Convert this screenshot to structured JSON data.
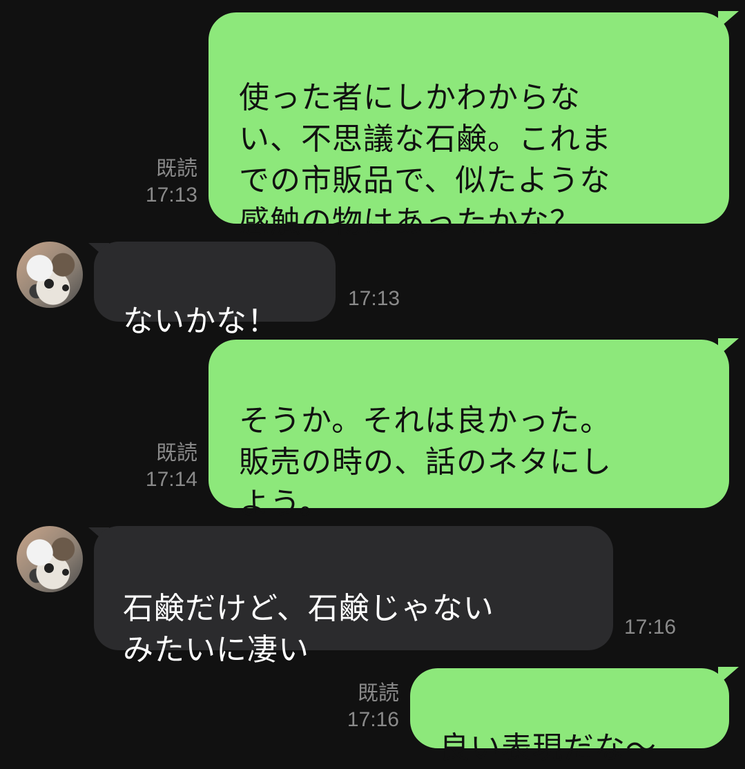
{
  "messages": [
    {
      "direction": "outgoing",
      "text": "使った者にしかわからな\nい、不思議な石鹸。これま\nでの市販品で、似たような\n感触の物はあったかな？",
      "read_label": "既読",
      "time": "17:13"
    },
    {
      "direction": "incoming",
      "text": "ないかな！",
      "time": "17:13",
      "avatar": "cat-avatar-icon"
    },
    {
      "direction": "outgoing",
      "text": "そうか。それは良かった。\n販売の時の、話のネタにし\nよう。",
      "read_label": "既読",
      "time": "17:14"
    },
    {
      "direction": "incoming",
      "text": "石鹸だけど、石鹸じゃない\nみたいに凄い",
      "time": "17:16",
      "avatar": "cat-avatar-icon"
    },
    {
      "direction": "outgoing",
      "text": "良い表現だな〜",
      "read_label": "既読",
      "time": "17:16"
    }
  ],
  "colors": {
    "background": "#111111",
    "outgoing_bubble": "#8de87b",
    "incoming_bubble": "#2b2b2d",
    "meta_text": "#8a8a8a"
  }
}
